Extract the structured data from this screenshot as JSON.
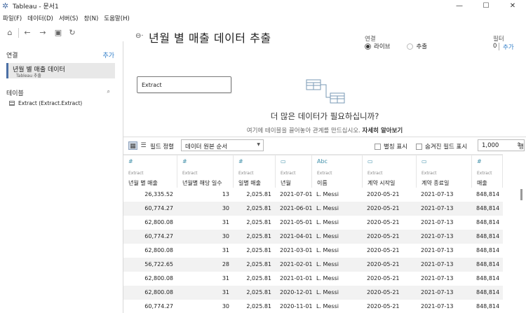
{
  "window": {
    "title": "Tableau - 문서1",
    "app_icon": "tableau-logo-icon"
  },
  "menu": [
    "파일(F)",
    "데이터(D)",
    "서버(S)",
    "창(N)",
    "도움말(H)"
  ],
  "toolbar": {
    "icons": [
      "home-icon",
      "back-icon",
      "forward-icon",
      "save-icon",
      "refresh-icon"
    ]
  },
  "left_panel": {
    "connections_label": "연결",
    "add_label": "추가",
    "connection": {
      "name": "년월 별 매출 데이터",
      "sub": "Tableau 추출"
    },
    "tables_label": "테이블",
    "table_item": "Extract (Extract.Extract)"
  },
  "header": {
    "title": "년월 별 매출 데이터 추출",
    "connection_label": "연결",
    "live_label": "라이브",
    "extract_label": "추출",
    "filter_label": "필터",
    "filter_count": "0",
    "filter_add": "추가"
  },
  "canvas": {
    "table_name": "Extract",
    "need_more": "더 많은 데이터가 필요하십니까?",
    "hint": "여기에 테이블을 끌어놓아 관계를 만드십시오.",
    "learn_more": "자세히 알아보기"
  },
  "grid_toolbar": {
    "sort_label": "필드 정렬",
    "sort_value": "데이터 원본 순서",
    "alias_label": "별칭 표시",
    "hidden_label": "숨겨진 필드 표시",
    "rows_value": "1,000",
    "rows_label": "행"
  },
  "columns": [
    {
      "type": "#",
      "source": "Extract",
      "name": "년월 별 매출"
    },
    {
      "type": "#",
      "source": "Extract",
      "name": "년월별 해당 일수"
    },
    {
      "type": "#",
      "source": "Extract",
      "name": "일별 매출"
    },
    {
      "type": "cal",
      "source": "Extract",
      "name": "년월"
    },
    {
      "type": "Abc",
      "source": "Extract",
      "name": "이름"
    },
    {
      "type": "cal",
      "source": "Extract",
      "name": "계약 시작일"
    },
    {
      "type": "cal",
      "source": "Extract",
      "name": "계약 종료일"
    },
    {
      "type": "#",
      "source": "Extract",
      "name": "매출"
    }
  ],
  "rows": [
    [
      "26,335.52",
      "13",
      "2,025.81",
      "2021-07-01",
      "L. Messi",
      "2020-05-21",
      "2021-07-13",
      "848,814"
    ],
    [
      "60,774.27",
      "30",
      "2,025.81",
      "2021-06-01",
      "L. Messi",
      "2020-05-21",
      "2021-07-13",
      "848,814"
    ],
    [
      "62,800.08",
      "31",
      "2,025.81",
      "2021-05-01",
      "L. Messi",
      "2020-05-21",
      "2021-07-13",
      "848,814"
    ],
    [
      "60,774.27",
      "30",
      "2,025.81",
      "2021-04-01",
      "L. Messi",
      "2020-05-21",
      "2021-07-13",
      "848,814"
    ],
    [
      "62,800.08",
      "31",
      "2,025.81",
      "2021-03-01",
      "L. Messi",
      "2020-05-21",
      "2021-07-13",
      "848,814"
    ],
    [
      "56,722.65",
      "28",
      "2,025.81",
      "2021-02-01",
      "L. Messi",
      "2020-05-21",
      "2021-07-13",
      "848,814"
    ],
    [
      "62,800.08",
      "31",
      "2,025.81",
      "2021-01-01",
      "L. Messi",
      "2020-05-21",
      "2021-07-13",
      "848,814"
    ],
    [
      "62,800.08",
      "31",
      "2,025.81",
      "2020-12-01",
      "L. Messi",
      "2020-05-21",
      "2021-07-13",
      "848,814"
    ],
    [
      "60,774.27",
      "30",
      "2,025.81",
      "2020-11-01",
      "L. Messi",
      "2020-05-21",
      "2021-07-13",
      "848,814"
    ]
  ]
}
